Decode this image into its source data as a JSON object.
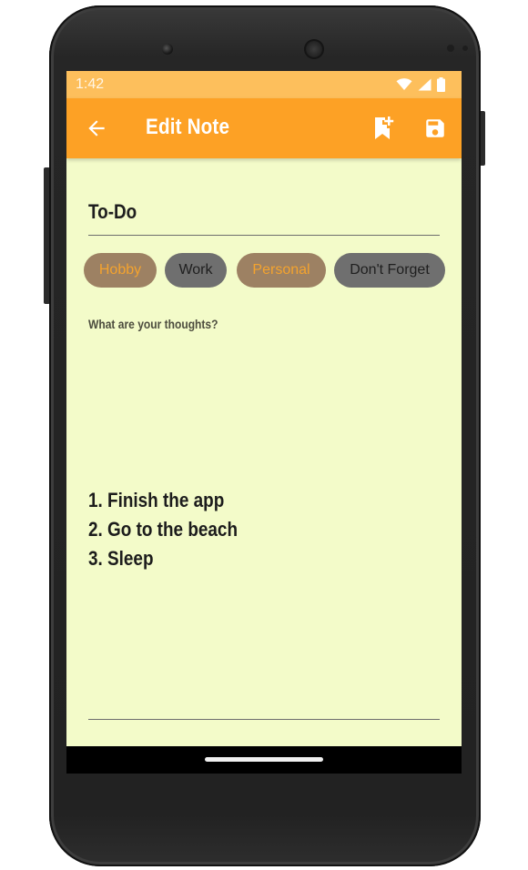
{
  "status_bar": {
    "time": "1:42"
  },
  "app_bar": {
    "title": "Edit Note"
  },
  "note": {
    "title": "To-Do",
    "body_lines": [
      "1. Finish the app",
      "2. Go to the beach",
      "3. Sleep"
    ],
    "body_placeholder": "What are your thoughts?"
  },
  "tags": [
    {
      "label": "Hobby",
      "selected": true
    },
    {
      "label": "Work",
      "selected": false
    },
    {
      "label": "Personal",
      "selected": true
    },
    {
      "label": "Don't Forget",
      "selected": false
    }
  ],
  "colors": {
    "app_bar": "#fda125",
    "status_bar": "#fdbf5c",
    "screen_background": "#f3fbc9",
    "chip_selected": "#9d8163",
    "chip_unselected": "#6f6f6f",
    "chip_selected_text": "#f4a32e"
  },
  "icons": {
    "back": "arrow-back-icon",
    "bookmark": "bookmark-add-icon",
    "save": "save-icon",
    "wifi": "wifi-icon",
    "signal": "signal-icon",
    "battery": "battery-icon"
  }
}
